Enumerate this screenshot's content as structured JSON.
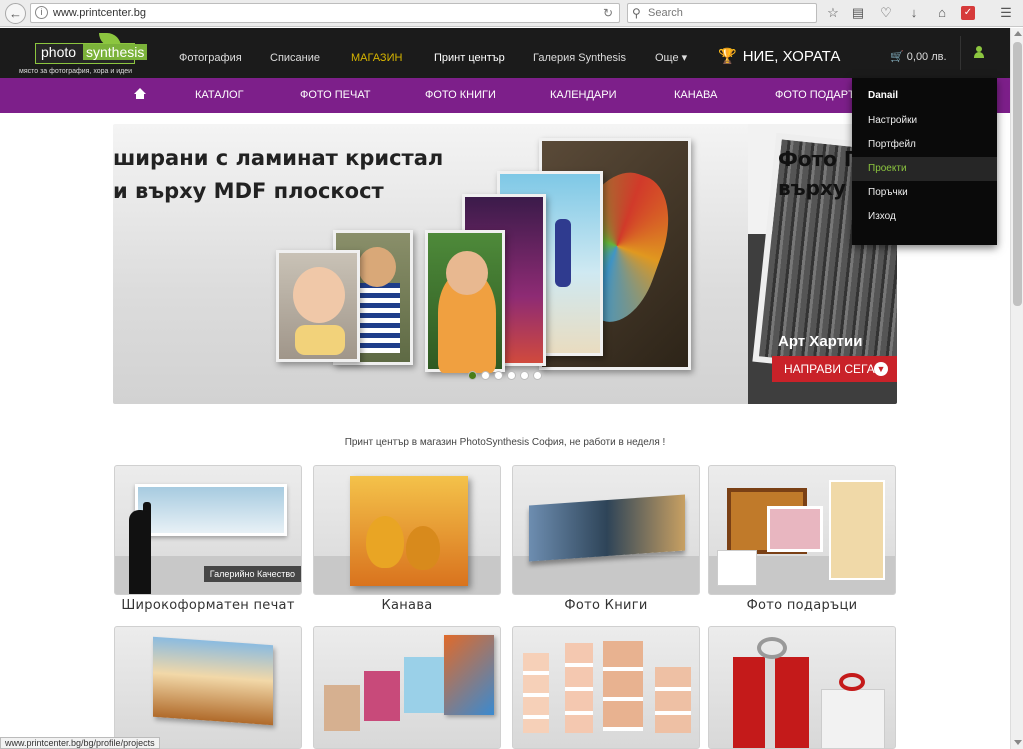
{
  "browser": {
    "url": "www.printcenter.bg",
    "search_placeholder": "Search",
    "status_url": "www.printcenter.bg/bg/profile/projects"
  },
  "header": {
    "logo_photo": "photo",
    "logo_synthesis": "synthesis",
    "logo_tagline": "място за фотография, хора и идеи",
    "nav": [
      "Фотография",
      "Списание",
      "МАГАЗИН",
      "Принт център",
      "Галерия Synthesis",
      "Още"
    ],
    "people": "НИЕ, ХОРАТА",
    "cart": "0,00 лв."
  },
  "catnav": {
    "items": [
      "КАТАЛОГ",
      "ФОТО ПЕЧАТ",
      "ФОТО КНИГИ",
      "КАЛЕНДАРИ",
      "КАНАВА",
      "ФОТО ПОДАРЪ"
    ]
  },
  "banner": {
    "line1": "ширани с ламинат кристал",
    "line2": "и върху MDF плоскост",
    "side_title1": "Фото П",
    "side_title2": "върху /",
    "side_art": "Арт Хартии",
    "cta": "НАПРАВИ СЕГА",
    "slides": 6,
    "active_slide": 1
  },
  "notice": "Принт център в магазин PhotoSynthesis София, не работи в неделя !",
  "tiles": [
    {
      "label": "Широкоформатен печат",
      "tag": "Галерийно Качество"
    },
    {
      "label": "Канава"
    },
    {
      "label": "Фото Книги"
    },
    {
      "label": "Фото подаръци"
    }
  ],
  "dropdown": {
    "username": "Danail",
    "items": [
      "Настройки",
      "Портфейл",
      "Проекти",
      "Поръчки",
      "Изход"
    ],
    "highlighted": "Проекти"
  },
  "colors": {
    "header_bg": "#1b1b1b",
    "purple_nav": "#7d1f8a",
    "accent_green": "#8cc63f",
    "cta_red": "#c92229",
    "shop_gold": "#d6b400"
  }
}
